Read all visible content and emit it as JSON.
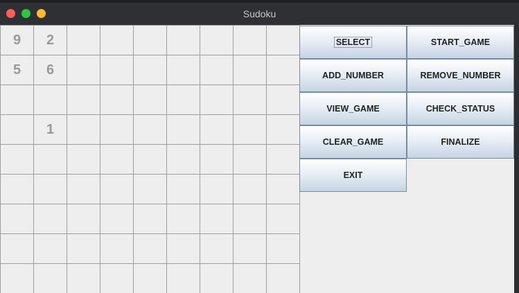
{
  "window": {
    "title": "Sudoku"
  },
  "grid": {
    "rows": [
      [
        "9",
        "2",
        "",
        "",
        "",
        "",
        "",
        "",
        ""
      ],
      [
        "5",
        "6",
        "",
        "",
        "",
        "",
        "",
        "",
        ""
      ],
      [
        "",
        "",
        "",
        "",
        "",
        "",
        "",
        "",
        ""
      ],
      [
        "",
        "1",
        "",
        "",
        "",
        "",
        "",
        "",
        ""
      ],
      [
        "",
        "",
        "",
        "",
        "",
        "",
        "",
        "",
        ""
      ],
      [
        "",
        "",
        "",
        "",
        "",
        "",
        "",
        "",
        ""
      ],
      [
        "",
        "",
        "",
        "",
        "",
        "",
        "",
        "",
        ""
      ],
      [
        "",
        "",
        "",
        "",
        "",
        "",
        "",
        "",
        ""
      ],
      [
        "",
        "",
        "",
        "",
        "",
        "",
        "",
        "",
        ""
      ]
    ]
  },
  "buttons": {
    "select": "SELECT",
    "start_game": "START_GAME",
    "add_number": "ADD_NUMBER",
    "remove_number": "REMOVE_NUMBER",
    "view_game": "VIEW_GAME",
    "check_status": "CHECK_STATUS",
    "clear_game": "CLEAR_GAME",
    "finalize": "FINALIZE",
    "exit": "EXIT"
  },
  "colors": {
    "close": "#ff5f57",
    "minimize": "#28c840",
    "maximize": "#febc2e",
    "given_digit": "#9a9a9a"
  }
}
